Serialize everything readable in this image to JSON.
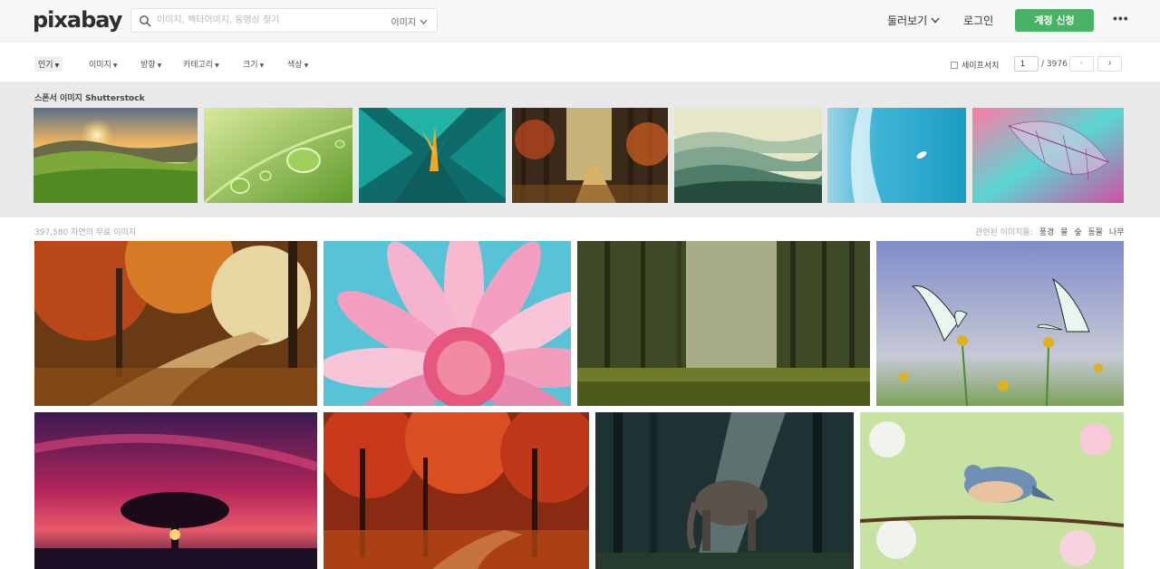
{
  "header": {
    "logo": "pixabay",
    "search_placeholder": "이미지, 벡터이미지, 동영상 찾기",
    "search_type": "이미지",
    "explore": "둘러보기",
    "login": "로그인",
    "signup": "계정 신청",
    "more": "•••"
  },
  "filters": {
    "items": [
      "인기",
      "이미지",
      "방향",
      "카테고리",
      "크기",
      "색상"
    ],
    "safesearch": "세이프서치",
    "page": "1",
    "total_pages": "/ 3976",
    "prev": "‹",
    "next": "›"
  },
  "sponsored": {
    "title": "스폰서 이미지 Shutterstock"
  },
  "results": {
    "count_label": "397,580 자연의 무료 이미지",
    "related_label": "관련된 이미지들:",
    "related_tags": [
      "풍경",
      "물",
      "숲",
      "동물",
      "나무"
    ]
  }
}
